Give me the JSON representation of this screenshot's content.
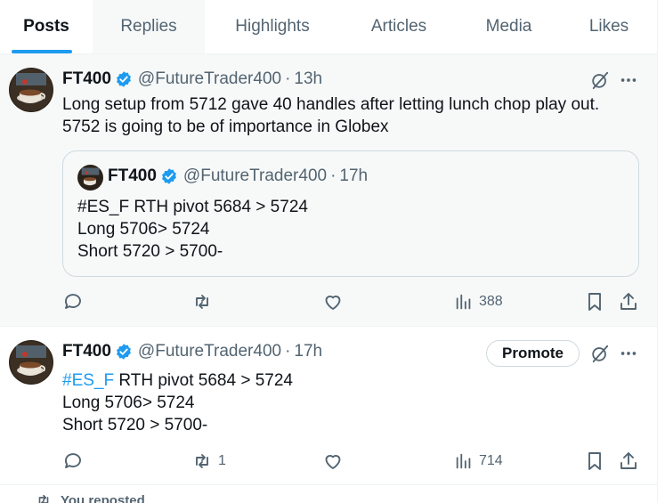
{
  "tabs": [
    {
      "label": "Posts",
      "active": true
    },
    {
      "label": "Replies"
    },
    {
      "label": "Highlights"
    },
    {
      "label": "Articles"
    },
    {
      "label": "Media"
    },
    {
      "label": "Likes"
    }
  ],
  "posts": [
    {
      "name": "FT400",
      "handle": "@FutureTrader400",
      "sep": "·",
      "time": "13h",
      "lines": [
        "Long setup from  5712 gave 40 handles after letting lunch chop play out.",
        "5752 is going to be of importance in Globex"
      ],
      "quote": {
        "name": "FT400",
        "handle": "@FutureTrader400",
        "sep": "·",
        "time": "17h",
        "lines": [
          "#ES_F RTH pivot  5684 > 5724",
          "Long 5706> 5724",
          "Short 5720 > 5700-"
        ]
      },
      "stats": {
        "replies": "",
        "reposts": "",
        "likes": "",
        "views": "388"
      }
    },
    {
      "name": "FT400",
      "handle": "@FutureTrader400",
      "sep": "·",
      "time": "17h",
      "promote_label": "Promote",
      "hashtag": "#ES_F",
      "first_line_rest": " RTH pivot  5684 > 5724",
      "lines": [
        "Long 5706> 5724",
        "Short 5720 > 5700-"
      ],
      "stats": {
        "replies": "",
        "reposts": "1",
        "likes": "",
        "views": "714"
      }
    }
  ],
  "reposted_label": "You reposted",
  "colors": {
    "accent": "#1d9bf0",
    "secondary_text": "#536471",
    "hover_bg": "#f7f9f9",
    "border": "#eff3f4"
  },
  "icons": [
    "verified-badge-icon",
    "grok-icon",
    "more-icon",
    "reply-icon",
    "repost-icon",
    "like-icon",
    "views-icon",
    "bookmark-icon",
    "share-icon"
  ]
}
